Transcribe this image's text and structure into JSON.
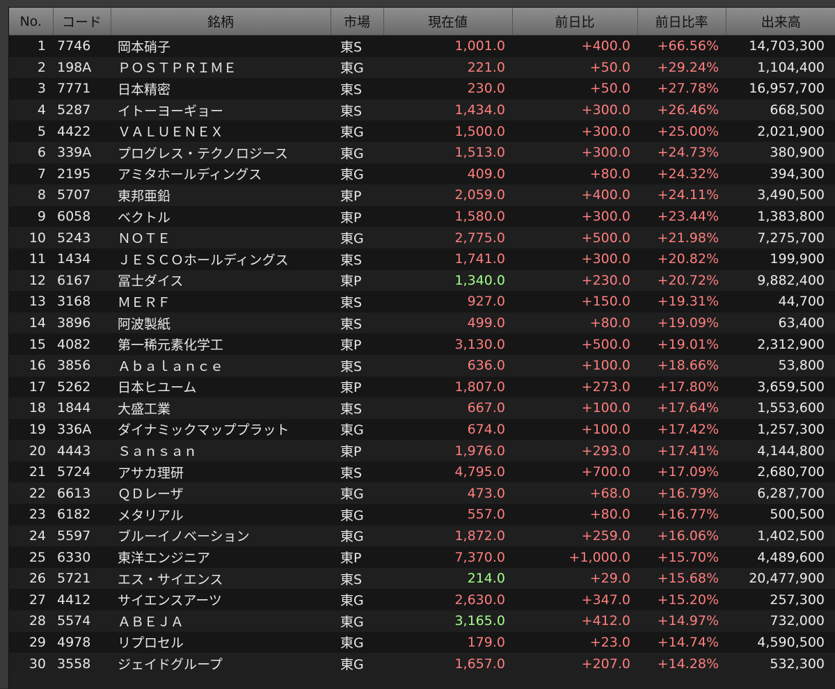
{
  "header": {
    "no": "No.",
    "code": "コード",
    "name": "銘柄",
    "market": "市場",
    "price": "現在値",
    "change": "前日比",
    "rate": "前日比率",
    "volume": "出来高"
  },
  "rows": [
    {
      "no": "1",
      "code": "7746",
      "name": "岡本硝子",
      "market": "東S",
      "price": "1,001.0",
      "change": "+400.0",
      "rate": "+66.56%",
      "volume": "14,703,300",
      "highlight": false
    },
    {
      "no": "2",
      "code": "198A",
      "name": "ＰＯＳＴＰＲＩＭＥ",
      "market": "東G",
      "price": "221.0",
      "change": "+50.0",
      "rate": "+29.24%",
      "volume": "1,104,400",
      "highlight": false
    },
    {
      "no": "3",
      "code": "7771",
      "name": "日本精密",
      "market": "東S",
      "price": "230.0",
      "change": "+50.0",
      "rate": "+27.78%",
      "volume": "16,957,700",
      "highlight": false
    },
    {
      "no": "4",
      "code": "5287",
      "name": "イトーヨーギョー",
      "market": "東S",
      "price": "1,434.0",
      "change": "+300.0",
      "rate": "+26.46%",
      "volume": "668,500",
      "highlight": false
    },
    {
      "no": "5",
      "code": "4422",
      "name": "ＶＡＬＵＥＮＥＸ",
      "market": "東G",
      "price": "1,500.0",
      "change": "+300.0",
      "rate": "+25.00%",
      "volume": "2,021,900",
      "highlight": false
    },
    {
      "no": "6",
      "code": "339A",
      "name": "プログレス・テクノロジース",
      "market": "東G",
      "price": "1,513.0",
      "change": "+300.0",
      "rate": "+24.73%",
      "volume": "380,900",
      "highlight": false
    },
    {
      "no": "7",
      "code": "2195",
      "name": "アミタホールディングス",
      "market": "東G",
      "price": "409.0",
      "change": "+80.0",
      "rate": "+24.32%",
      "volume": "394,300",
      "highlight": false
    },
    {
      "no": "8",
      "code": "5707",
      "name": "東邦亜鉛",
      "market": "東P",
      "price": "2,059.0",
      "change": "+400.0",
      "rate": "+24.11%",
      "volume": "3,490,500",
      "highlight": false
    },
    {
      "no": "9",
      "code": "6058",
      "name": "ベクトル",
      "market": "東P",
      "price": "1,580.0",
      "change": "+300.0",
      "rate": "+23.44%",
      "volume": "1,383,800",
      "highlight": false
    },
    {
      "no": "10",
      "code": "5243",
      "name": "ＮＯＴＥ",
      "market": "東G",
      "price": "2,775.0",
      "change": "+500.0",
      "rate": "+21.98%",
      "volume": "7,275,700",
      "highlight": false
    },
    {
      "no": "11",
      "code": "1434",
      "name": "ＪＥＳＣＯホールディングス",
      "market": "東S",
      "price": "1,741.0",
      "change": "+300.0",
      "rate": "+20.82%",
      "volume": "199,900",
      "highlight": false
    },
    {
      "no": "12",
      "code": "6167",
      "name": "冨士ダイス",
      "market": "東P",
      "price": "1,340.0",
      "change": "+230.0",
      "rate": "+20.72%",
      "volume": "9,882,400",
      "highlight": true
    },
    {
      "no": "13",
      "code": "3168",
      "name": "ＭＥＲＦ",
      "market": "東S",
      "price": "927.0",
      "change": "+150.0",
      "rate": "+19.31%",
      "volume": "44,700",
      "highlight": false
    },
    {
      "no": "14",
      "code": "3896",
      "name": "阿波製紙",
      "market": "東S",
      "price": "499.0",
      "change": "+80.0",
      "rate": "+19.09%",
      "volume": "63,400",
      "highlight": false
    },
    {
      "no": "15",
      "code": "4082",
      "name": "第一稀元素化学工",
      "market": "東P",
      "price": "3,130.0",
      "change": "+500.0",
      "rate": "+19.01%",
      "volume": "2,312,900",
      "highlight": false
    },
    {
      "no": "16",
      "code": "3856",
      "name": "Ａｂａｌａｎｃｅ",
      "market": "東S",
      "price": "636.0",
      "change": "+100.0",
      "rate": "+18.66%",
      "volume": "53,800",
      "highlight": false
    },
    {
      "no": "17",
      "code": "5262",
      "name": "日本ヒユーム",
      "market": "東P",
      "price": "1,807.0",
      "change": "+273.0",
      "rate": "+17.80%",
      "volume": "3,659,500",
      "highlight": false
    },
    {
      "no": "18",
      "code": "1844",
      "name": "大盛工業",
      "market": "東S",
      "price": "667.0",
      "change": "+100.0",
      "rate": "+17.64%",
      "volume": "1,553,600",
      "highlight": false
    },
    {
      "no": "19",
      "code": "336A",
      "name": "ダイナミックマッププラット",
      "market": "東G",
      "price": "674.0",
      "change": "+100.0",
      "rate": "+17.42%",
      "volume": "1,257,300",
      "highlight": false
    },
    {
      "no": "20",
      "code": "4443",
      "name": "Ｓａｎｓａｎ",
      "market": "東P",
      "price": "1,976.0",
      "change": "+293.0",
      "rate": "+17.41%",
      "volume": "4,144,800",
      "highlight": false
    },
    {
      "no": "21",
      "code": "5724",
      "name": "アサカ理研",
      "market": "東S",
      "price": "4,795.0",
      "change": "+700.0",
      "rate": "+17.09%",
      "volume": "2,680,700",
      "highlight": false
    },
    {
      "no": "22",
      "code": "6613",
      "name": "ＱＤレーザ",
      "market": "東G",
      "price": "473.0",
      "change": "+68.0",
      "rate": "+16.79%",
      "volume": "6,287,700",
      "highlight": false
    },
    {
      "no": "23",
      "code": "6182",
      "name": "メタリアル",
      "market": "東G",
      "price": "557.0",
      "change": "+80.0",
      "rate": "+16.77%",
      "volume": "500,500",
      "highlight": false
    },
    {
      "no": "24",
      "code": "5597",
      "name": "ブルーイノベーション",
      "market": "東G",
      "price": "1,872.0",
      "change": "+259.0",
      "rate": "+16.06%",
      "volume": "1,402,500",
      "highlight": false
    },
    {
      "no": "25",
      "code": "6330",
      "name": "東洋エンジニア",
      "market": "東P",
      "price": "7,370.0",
      "change": "+1,000.0",
      "rate": "+15.70%",
      "volume": "4,489,600",
      "highlight": false
    },
    {
      "no": "26",
      "code": "5721",
      "name": "エス・サイエンス",
      "market": "東S",
      "price": "214.0",
      "change": "+29.0",
      "rate": "+15.68%",
      "volume": "20,477,900",
      "highlight": true
    },
    {
      "no": "27",
      "code": "4412",
      "name": "サイエンスアーツ",
      "market": "東G",
      "price": "2,630.0",
      "change": "+347.0",
      "rate": "+15.20%",
      "volume": "257,300",
      "highlight": false
    },
    {
      "no": "28",
      "code": "5574",
      "name": "ＡＢＥＪＡ",
      "market": "東G",
      "price": "3,165.0",
      "change": "+412.0",
      "rate": "+14.97%",
      "volume": "732,000",
      "highlight": true
    },
    {
      "no": "29",
      "code": "4978",
      "name": "リプロセル",
      "market": "東G",
      "price": "179.0",
      "change": "+23.0",
      "rate": "+14.74%",
      "volume": "4,590,500",
      "highlight": false
    },
    {
      "no": "30",
      "code": "3558",
      "name": "ジェイドグループ",
      "market": "東G",
      "price": "1,657.0",
      "change": "+207.0",
      "rate": "+14.28%",
      "volume": "532,300",
      "highlight": false
    }
  ]
}
